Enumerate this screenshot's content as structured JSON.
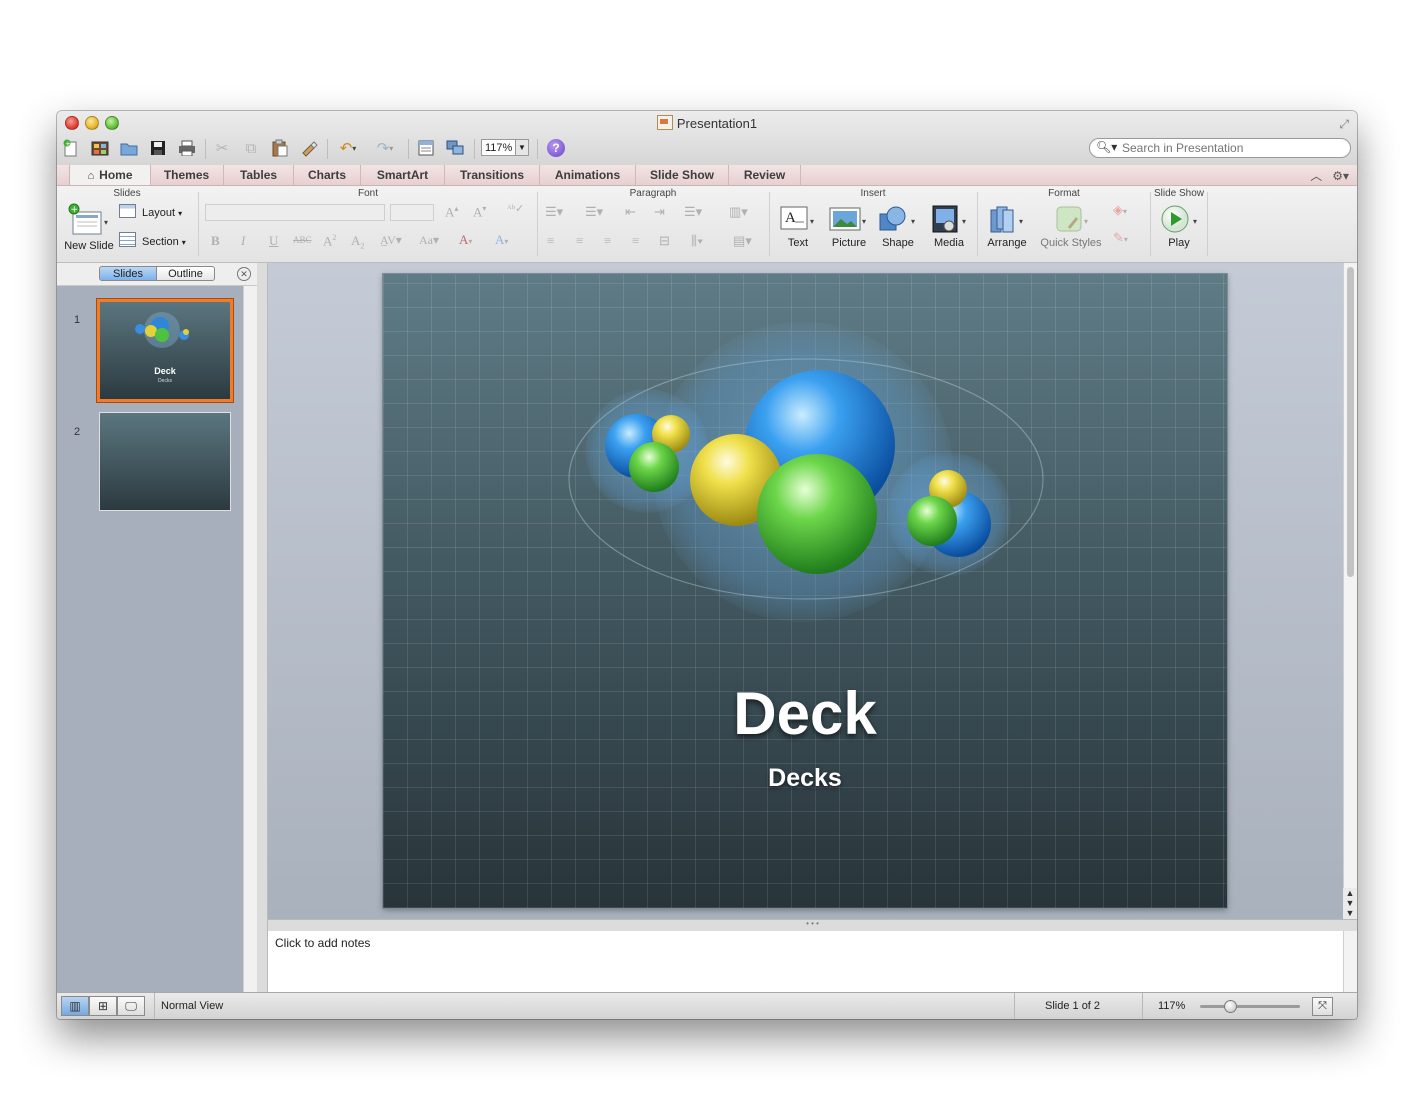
{
  "window": {
    "title": "Presentation1"
  },
  "search": {
    "placeholder": "Search in Presentation"
  },
  "toolbar": {
    "zoom": "117%",
    "help": "?"
  },
  "ribbon_tabs": [
    "Home",
    "Themes",
    "Tables",
    "Charts",
    "SmartArt",
    "Transitions",
    "Animations",
    "Slide Show",
    "Review"
  ],
  "ribbon": {
    "groups": {
      "slides": "Slides",
      "font": "Font",
      "paragraph": "Paragraph",
      "insert": "Insert",
      "format": "Format",
      "slideshow": "Slide Show"
    },
    "new_slide": "New Slide",
    "layout": "Layout",
    "section": "Section",
    "text": "Text",
    "picture": "Picture",
    "shape": "Shape",
    "media": "Media",
    "arrange": "Arrange",
    "quick_styles": "Quick Styles",
    "play": "Play"
  },
  "sidebar": {
    "tab_slides": "Slides",
    "tab_outline": "Outline",
    "thumb1_num": "1",
    "thumb2_num": "2",
    "thumb1_title": "Deck",
    "thumb1_sub": "Decks"
  },
  "slide": {
    "title": "Deck",
    "subtitle": "Decks"
  },
  "notes": {
    "placeholder": "Click to add notes"
  },
  "status": {
    "view": "Normal View",
    "slide_pos": "Slide 1 of 2",
    "zoom": "117%"
  },
  "colors": {
    "accent_selected": "#f07c2b",
    "ribbon_tab_bg": "#f3e4e4"
  }
}
